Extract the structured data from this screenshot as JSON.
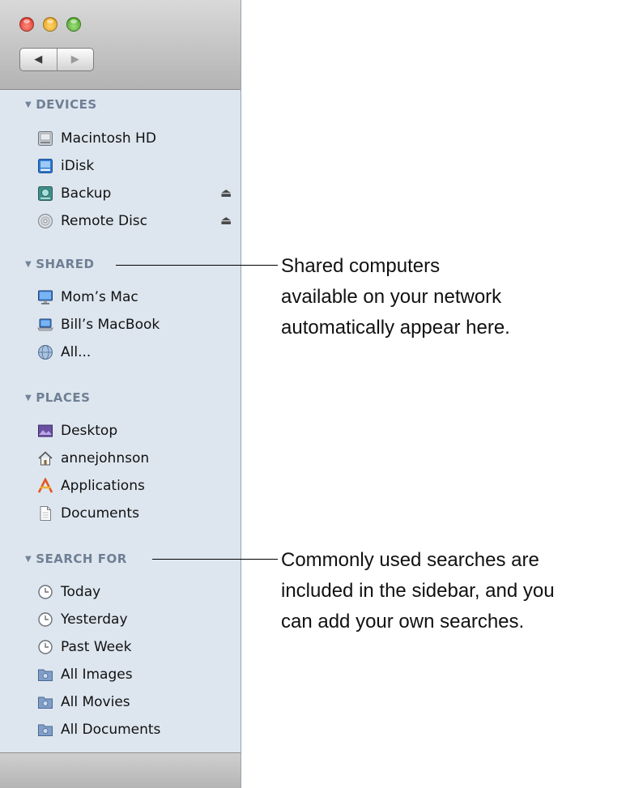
{
  "sidebar": {
    "nav": {
      "back_icon": "◀",
      "forward_icon": "▶"
    },
    "sections": {
      "devices": {
        "label": "DEVICES",
        "items": [
          {
            "label": "Macintosh HD",
            "icon": "hard-drive-icon"
          },
          {
            "label": "iDisk",
            "icon": "idisk-icon"
          },
          {
            "label": "Backup",
            "icon": "backup-drive-icon",
            "eject": "⏏"
          },
          {
            "label": "Remote Disc",
            "icon": "optical-disc-icon",
            "eject": "⏏"
          }
        ]
      },
      "shared": {
        "label": "SHARED",
        "items": [
          {
            "label": "Mom’s Mac",
            "icon": "imac-icon"
          },
          {
            "label": "Bill’s MacBook",
            "icon": "macbook-icon"
          },
          {
            "label": "All...",
            "icon": "network-globe-icon"
          }
        ]
      },
      "places": {
        "label": "PLACES",
        "items": [
          {
            "label": "Desktop",
            "icon": "desktop-icon"
          },
          {
            "label": "annejohnson",
            "icon": "home-icon"
          },
          {
            "label": "Applications",
            "icon": "applications-icon"
          },
          {
            "label": "Documents",
            "icon": "documents-icon"
          }
        ]
      },
      "search_for": {
        "label": "SEARCH FOR",
        "items": [
          {
            "label": "Today",
            "icon": "clock-icon"
          },
          {
            "label": "Yesterday",
            "icon": "clock-icon"
          },
          {
            "label": "Past Week",
            "icon": "clock-icon"
          },
          {
            "label": "All Images",
            "icon": "smart-folder-icon"
          },
          {
            "label": "All Movies",
            "icon": "smart-folder-icon"
          },
          {
            "label": "All Documents",
            "icon": "smart-folder-icon"
          }
        ]
      }
    }
  },
  "callouts": {
    "shared": {
      "lines": [
        "Shared computers",
        "available on your network",
        "automatically appear here."
      ]
    },
    "search": {
      "lines": [
        "Commonly used searches are",
        "included in the sidebar, and you",
        "can add your own searches."
      ]
    }
  },
  "colors": {
    "sidebar_bg": "#dde6ef",
    "section_header": "#6f7f94",
    "close": "#d8291a",
    "minimize": "#e19a0d",
    "zoom": "#3f9a1d"
  }
}
